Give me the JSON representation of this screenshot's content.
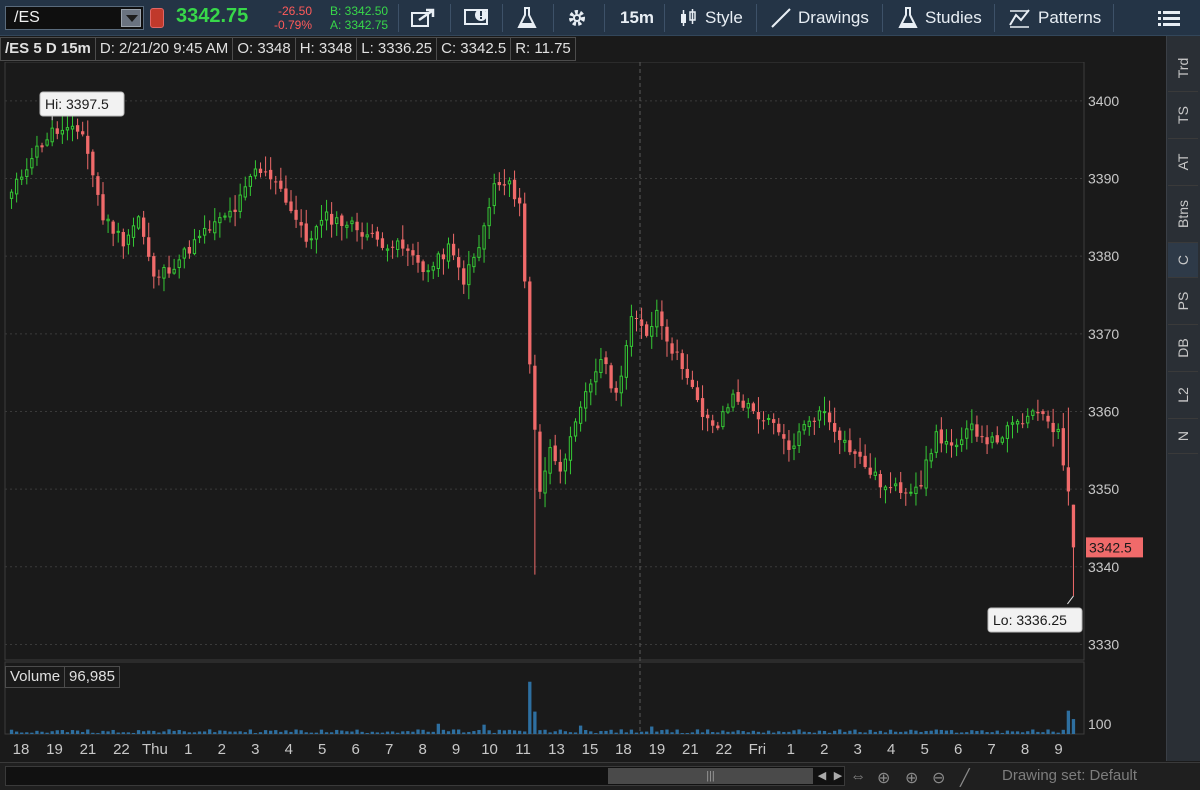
{
  "toolbar": {
    "symbol": "/ES",
    "last_price": "3342.75",
    "net_change": "-26.50",
    "pct_change": "-0.79%",
    "bid": "B: 3342.50",
    "ask": "A: 3342.75",
    "timeframe": "15m",
    "style_label": "Style",
    "drawings_label": "Drawings",
    "studies_label": "Studies",
    "patterns_label": "Patterns",
    "icons": [
      "share-icon",
      "alert-flag-icon",
      "flask-icon",
      "gear-icon",
      "candle-icon",
      "pencil-line-icon",
      "flask-studies-icon",
      "patterns-icon",
      "menu-icon"
    ]
  },
  "chart_header": {
    "title": "/ES 5 D 15m",
    "date": "D: 2/21/20 9:45 AM",
    "open": "O: 3348",
    "high": "H: 3348",
    "low": "L: 3336.25",
    "close": "C: 3342.5",
    "range": "R: 11.75"
  },
  "side_tabs": [
    "Trd",
    "TS",
    "AT",
    "Btns",
    "C",
    "PS",
    "DB",
    "L2",
    "N"
  ],
  "side_tab_active": "C",
  "volume": {
    "label": "Volume",
    "value": "96,985",
    "axis_label": "100"
  },
  "scrollbar": {
    "drawing_set": "Drawing set: Default"
  },
  "colors": {
    "up": "#35c935",
    "down": "#f06a6a",
    "background": "#1a1a1a",
    "grid": "#3a3a3a",
    "toolbar": "#243446",
    "volume": "#2e6fa0"
  },
  "chart_data": {
    "type": "candlestick",
    "ylim": [
      3328,
      3405
    ],
    "y_ticks": [
      3400,
      3390,
      3380,
      3370,
      3360,
      3350,
      3340,
      3330
    ],
    "current_price_label": "3342.5",
    "hi_label": "Hi: 3397.5",
    "lo_label": "Lo: 3336.25",
    "x_tick_labels": [
      "18",
      "19",
      "21",
      "22",
      "Thu",
      "1",
      "2",
      "3",
      "4",
      "5",
      "6",
      "7",
      "8",
      "9",
      "10",
      "11",
      "13",
      "15",
      "18",
      "19",
      "21",
      "22",
      "Fri",
      "1",
      "2",
      "3",
      "4",
      "5",
      "6",
      "7",
      "8",
      "9"
    ],
    "anchors": [
      [
        0,
        3388
      ],
      [
        4,
        3393
      ],
      [
        8,
        3396
      ],
      [
        14,
        3396
      ],
      [
        18,
        3385
      ],
      [
        22,
        3382
      ],
      [
        25,
        3385
      ],
      [
        28,
        3377
      ],
      [
        32,
        3379
      ],
      [
        38,
        3383
      ],
      [
        44,
        3386
      ],
      [
        48,
        3391
      ],
      [
        52,
        3390
      ],
      [
        58,
        3382
      ],
      [
        62,
        3385
      ],
      [
        67,
        3384
      ],
      [
        72,
        3382
      ],
      [
        77,
        3381
      ],
      [
        82,
        3378
      ],
      [
        86,
        3381
      ],
      [
        89,
        3377
      ],
      [
        92,
        3381
      ],
      [
        95,
        3389
      ],
      [
        98,
        3389
      ],
      [
        100,
        3387
      ],
      [
        102,
        3366
      ],
      [
        104,
        3350
      ],
      [
        106,
        3355
      ],
      [
        108,
        3353
      ],
      [
        110,
        3356
      ],
      [
        113,
        3362
      ],
      [
        116,
        3367
      ],
      [
        119,
        3362
      ],
      [
        122,
        3372
      ],
      [
        125,
        3370
      ],
      [
        127,
        3373
      ],
      [
        130,
        3368
      ],
      [
        133,
        3365
      ],
      [
        136,
        3359
      ],
      [
        139,
        3358
      ],
      [
        142,
        3362
      ],
      [
        146,
        3360
      ],
      [
        150,
        3358
      ],
      [
        153,
        3355
      ],
      [
        157,
        3359
      ],
      [
        160,
        3360
      ],
      [
        164,
        3356
      ],
      [
        168,
        3353
      ],
      [
        172,
        3350
      ],
      [
        176,
        3350
      ],
      [
        179,
        3351
      ],
      [
        182,
        3357
      ],
      [
        186,
        3355
      ],
      [
        189,
        3358
      ],
      [
        193,
        3356
      ],
      [
        197,
        3358
      ],
      [
        200,
        3359
      ],
      [
        203,
        3360
      ],
      [
        206,
        3357
      ],
      [
        208,
        3350
      ],
      [
        209,
        3342.5
      ]
    ],
    "volume_spikes": [
      [
        84,
        11
      ],
      [
        93,
        10
      ],
      [
        102,
        56
      ],
      [
        103,
        24
      ],
      [
        112,
        9
      ],
      [
        126,
        8
      ],
      [
        208,
        25
      ],
      [
        209,
        16
      ]
    ]
  }
}
